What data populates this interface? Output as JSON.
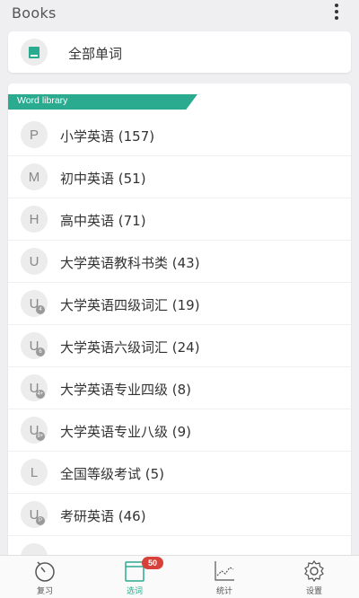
{
  "header": {
    "title": "Books"
  },
  "all_words": {
    "label": "全部单词",
    "icon": "book-icon"
  },
  "library": {
    "ribbon": "Word library",
    "items": [
      {
        "letter": "P",
        "sub": "",
        "label": "小学英语 (157)"
      },
      {
        "letter": "M",
        "sub": "",
        "label": "初中英语 (51)"
      },
      {
        "letter": "H",
        "sub": "",
        "label": "高中英语 (71)"
      },
      {
        "letter": "U",
        "sub": "",
        "label": "大学英语教科书类 (43)"
      },
      {
        "letter": "U",
        "sub": "4",
        "label": "大学英语四级词汇 (19)"
      },
      {
        "letter": "U",
        "sub": "6",
        "label": "大学英语六级词汇 (24)"
      },
      {
        "letter": "U",
        "sub": "4+",
        "label": "大学英语专业四级 (8)"
      },
      {
        "letter": "U",
        "sub": "8+",
        "label": "大学英语专业八级 (9)"
      },
      {
        "letter": "L",
        "sub": "",
        "label": "全国等级考试 (5)"
      },
      {
        "letter": "U",
        "sub": "P",
        "label": "考研英语 (46)"
      },
      {
        "letter": "",
        "sub": "",
        "label": ""
      }
    ]
  },
  "nav": {
    "review": "复习",
    "select": "选词",
    "select_badge": "50",
    "stats": "统计",
    "settings": "设置"
  },
  "colors": {
    "accent": "#2aaa8e",
    "badge": "#d8403a"
  }
}
